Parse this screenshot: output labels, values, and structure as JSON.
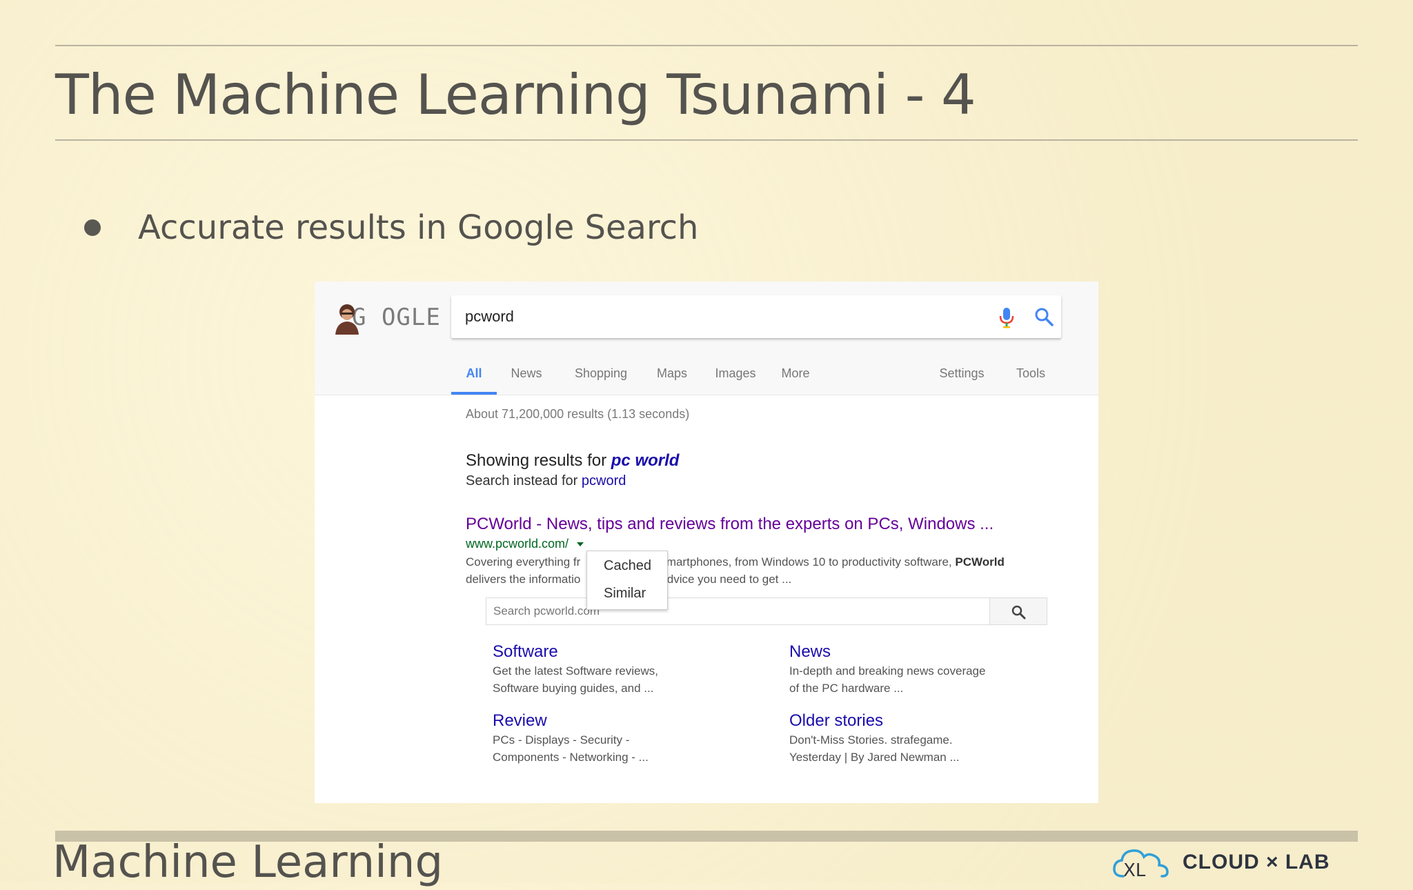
{
  "slide": {
    "title": "The Machine Learning Tsunami - 4",
    "bullet": "Accurate results in Google Search",
    "footer_title": "Machine Learning"
  },
  "brand": {
    "logo_text": "CLOUD × LAB",
    "icon": "cloud-icon",
    "color": "#2e3440"
  },
  "google": {
    "logo_text": "G OGLE",
    "search_value": "pcword",
    "tabs": [
      "All",
      "News",
      "Shopping",
      "Maps",
      "Images",
      "More",
      "Settings",
      "Tools"
    ],
    "active_tab": "All",
    "stats": "About 71,200,000 results (1.13 seconds)",
    "showing_prefix": "Showing results for",
    "showing_corrected": "pc world",
    "instead_prefix": "Search instead for",
    "instead_original": "pcword",
    "result": {
      "title": "PCWorld - News, tips and reviews from the experts on PCs, Windows ...",
      "url": "www.pcworld.com/",
      "snippet_line1_a": "Covering everything fr",
      "snippet_line1_b": "smartphones, from Windows 10 to productivity software,",
      "snippet_bold": "PCWorld",
      "snippet_line2_a": "delivers the informatio",
      "snippet_line2_b": "advice you need to get ..."
    },
    "dropdown": [
      "Cached",
      "Similar"
    ],
    "site_search_placeholder": "Search pcworld.com",
    "sitelinks": [
      {
        "title": "Software",
        "desc": "Get the latest Software reviews,\nSoftware buying guides, and ..."
      },
      {
        "title": "News",
        "desc": "In-depth and breaking news coverage\nof the PC hardware ..."
      },
      {
        "title": "Review",
        "desc": "PCs - Displays - Security -\nComponents - Networking - ..."
      },
      {
        "title": "Older stories",
        "desc": "Don't-Miss Stories. strafegame.\nYesterday | By Jared Newman ..."
      }
    ],
    "colors": {
      "link": "#1a0dab",
      "visited": "#660099",
      "url": "#006621",
      "accent": "#4285f4"
    }
  }
}
